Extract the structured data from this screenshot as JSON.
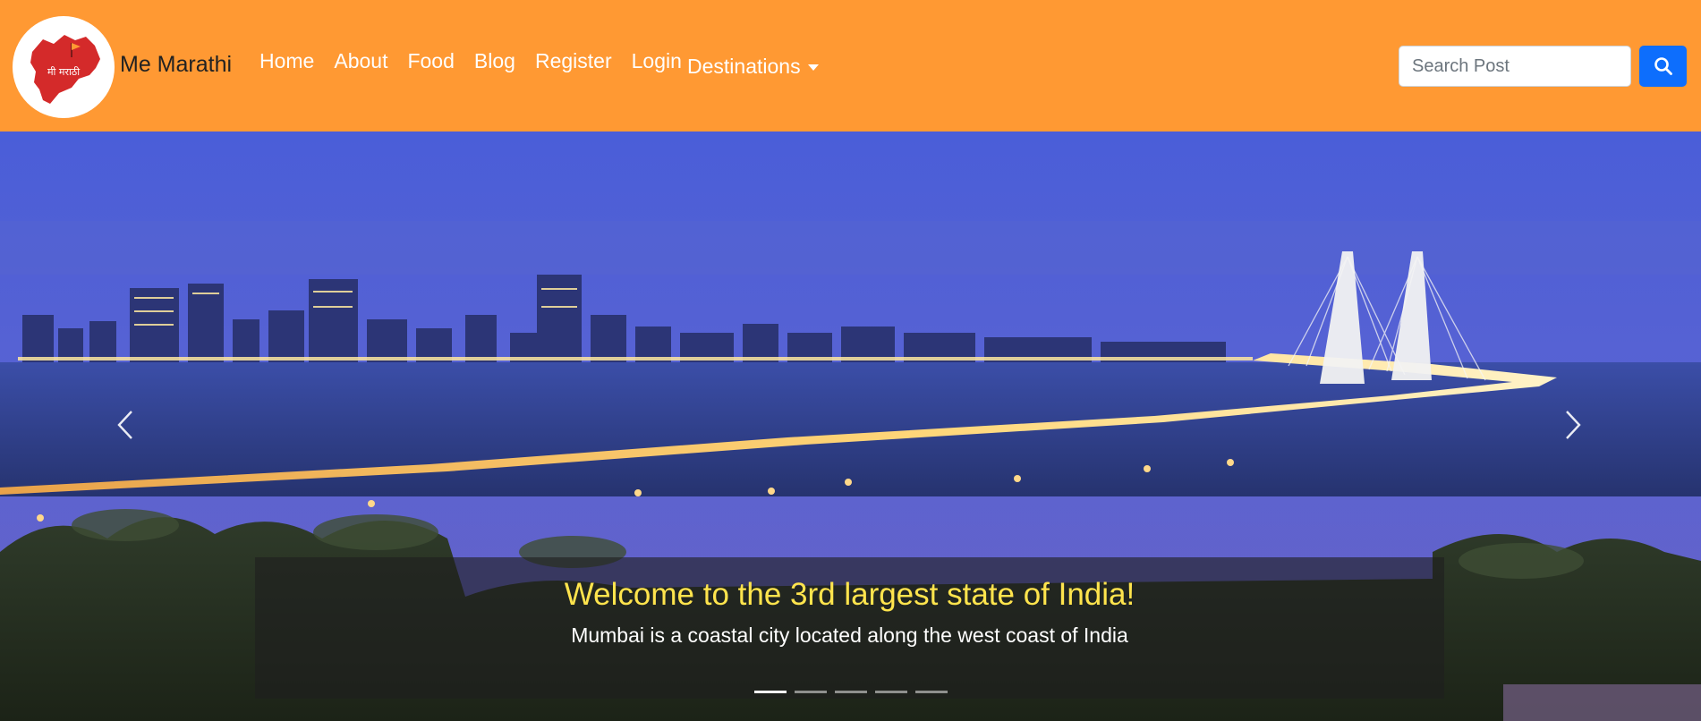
{
  "brand": {
    "name": "Me Marathi",
    "logo_text": "मी मराठी"
  },
  "nav": {
    "links": [
      {
        "label": "Home"
      },
      {
        "label": "About"
      },
      {
        "label": "Food"
      },
      {
        "label": "Blog"
      },
      {
        "label": "Register"
      },
      {
        "label": "Login"
      }
    ],
    "dropdown_label": "Destinations"
  },
  "search": {
    "placeholder": "Search Post",
    "icon": "search-icon"
  },
  "carousel": {
    "caption_title": "Welcome to the 3rd largest state of India!",
    "caption_text": "Mumbai is a coastal city located along the west coast of India",
    "slide_count": 5,
    "active_slide": 1,
    "prev_icon": "chevron-left-icon",
    "next_icon": "chevron-right-icon"
  },
  "colors": {
    "navbar": "#ff9933",
    "search_button": "#0d6efd",
    "caption_title": "#ffe44d"
  }
}
